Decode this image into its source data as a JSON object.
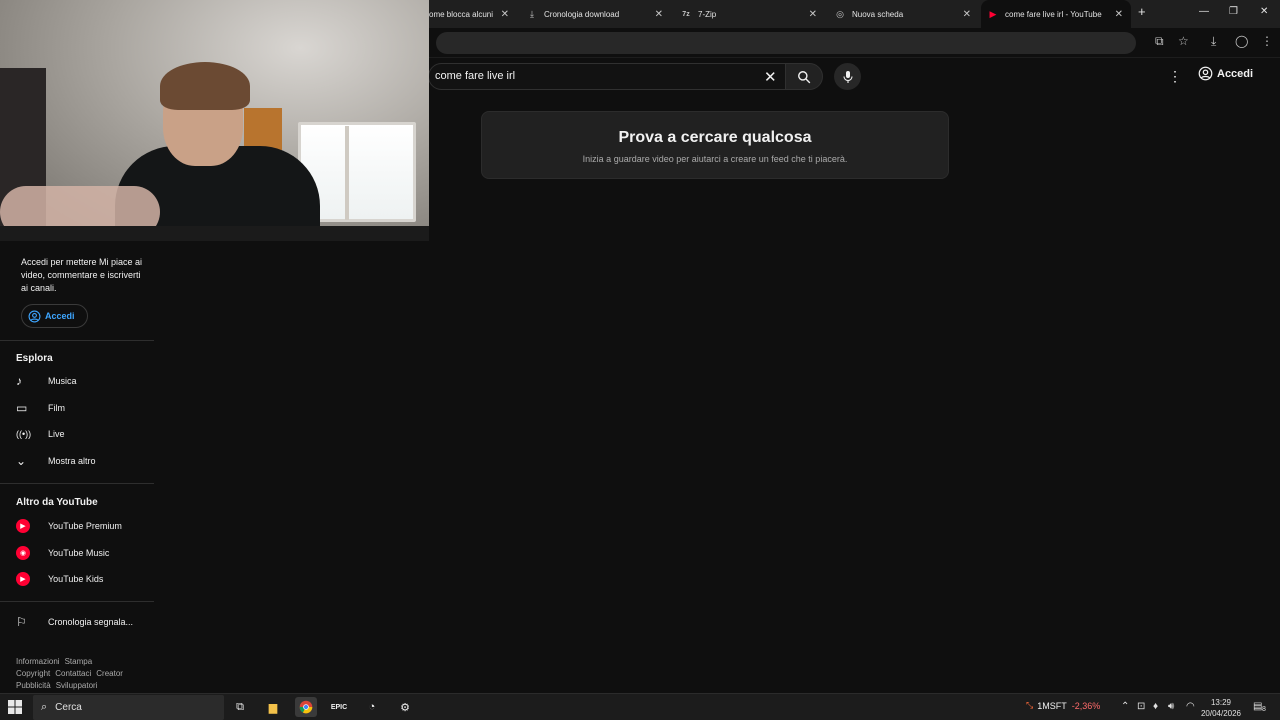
{
  "browser": {
    "tabs": [
      {
        "title": "ome blocca alcuni",
        "icon": "page-icon",
        "active": false
      },
      {
        "title": "Cronologia download",
        "icon": "download-icon",
        "active": false
      },
      {
        "title": "7-Zip",
        "icon": "7zip-icon",
        "active": false
      },
      {
        "title": "Nuova scheda",
        "icon": "chrome-icon",
        "active": false
      },
      {
        "title": "come fare live irl - YouTube",
        "icon": "youtube-icon",
        "active": true
      }
    ],
    "new_tab_label": "+",
    "controls": {
      "minimize": "—",
      "maximize": "❐",
      "close": "✕"
    }
  },
  "youtube": {
    "search": {
      "value": "come fare live irl"
    },
    "header": {
      "signin_label": "Accedi"
    },
    "empty_state": {
      "title": "Prova a cercare qualcosa",
      "subtitle": "Inizia a guardare video per aiutarci a creare un feed che ti piacerà."
    },
    "sidebar": {
      "signin_text": "Accedi per mettere Mi piace ai video, commentare e iscriverti ai canali.",
      "signin_button": "Accedi",
      "explore_title": "Esplora",
      "explore_items": [
        {
          "label": "Musica",
          "icon": "music-note-icon"
        },
        {
          "label": "Film",
          "icon": "film-icon"
        },
        {
          "label": "Live",
          "icon": "live-icon"
        },
        {
          "label": "Mostra altro",
          "icon": "chevron-down-icon"
        }
      ],
      "more_title": "Altro da YouTube",
      "more_items": [
        {
          "label": "YouTube Premium",
          "icon": "youtube-premium-icon"
        },
        {
          "label": "YouTube Music",
          "icon": "youtube-music-icon"
        },
        {
          "label": "YouTube Kids",
          "icon": "youtube-kids-icon"
        }
      ],
      "report_item": {
        "label": "Cronologia segnala...",
        "icon": "flag-icon"
      },
      "footer_links": [
        "Informazioni",
        "Stampa",
        "Copyright",
        "Contattaci",
        "Creator",
        "Pubblicità",
        "Sviluppatori"
      ]
    }
  },
  "taskbar": {
    "search_placeholder": "Cerca",
    "stock": {
      "symbol": "1MSFT",
      "change": "-2,36%"
    },
    "time": "13:29",
    "date": "20/04/2026",
    "notification_count": "8"
  },
  "colors": {
    "background": "#0f0f0f",
    "accent": "#3ea6ff",
    "brand_red": "#ff0033"
  }
}
